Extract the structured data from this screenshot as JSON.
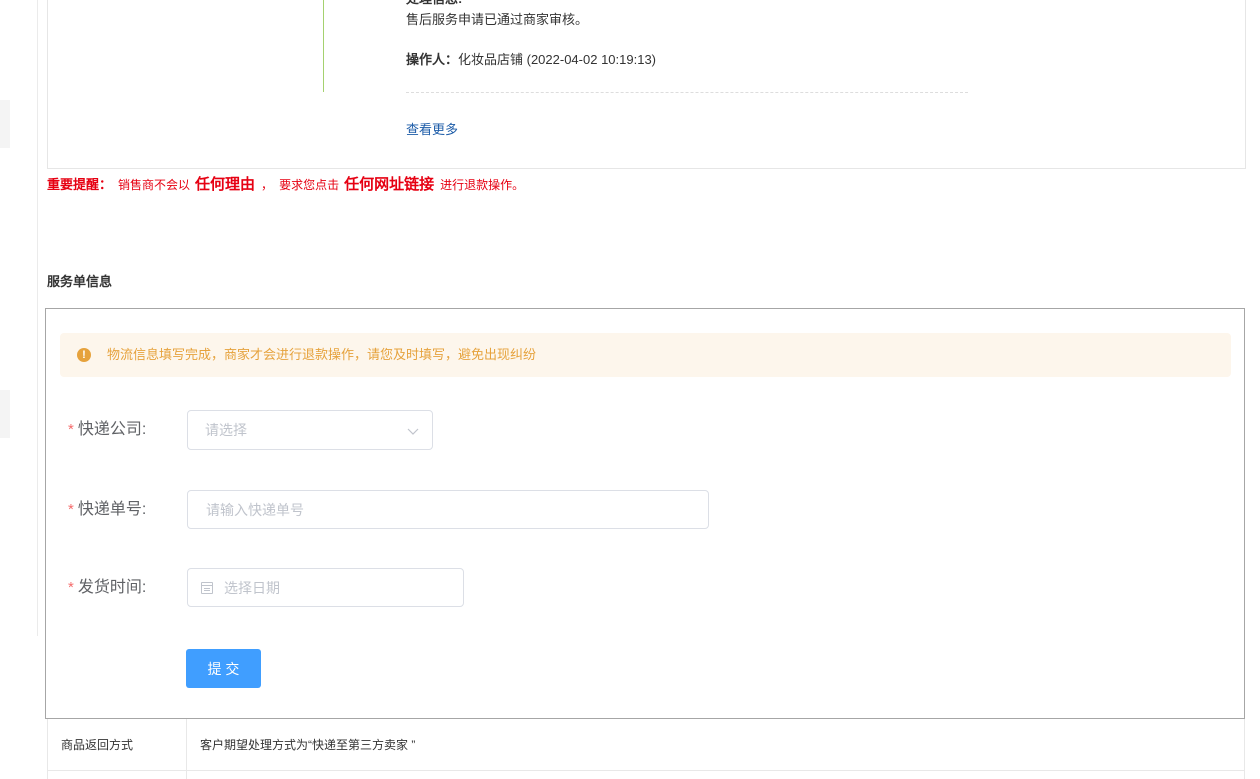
{
  "timeline": {
    "heading": "处理信息:",
    "message": "售后服务申请已通过商家审核。",
    "operator_label": "操作人：",
    "operator_value": "化妆品店铺 (2022-04-02 10:19:13)",
    "more_link": "查看更多"
  },
  "notice": {
    "label": "重要提醒：",
    "part1": "销售商不会以",
    "emphasis1": "任何理由",
    "part2": "，",
    "part3": "要求您点击",
    "emphasis2": "任何网址链接",
    "part4": "进行退款操作。"
  },
  "section_title": "服务单信息",
  "alert": {
    "icon": "warning-circle-icon",
    "icon_glyph": "!",
    "text": "物流信息填写完成，商家才会进行退款操作，请您及时填写，避免出现纠纷"
  },
  "form": {
    "required_mark": "*",
    "courier": {
      "label": "快递公司:",
      "placeholder": "请选择",
      "value": "",
      "icon": "chevron-down-icon"
    },
    "tracking": {
      "label": "快递单号:",
      "placeholder": "请输入快递单号",
      "value": ""
    },
    "ship_date": {
      "label": "发货时间:",
      "placeholder": "选择日期",
      "value": "",
      "icon": "calendar-icon"
    },
    "submit_label": "提 交"
  },
  "table": {
    "rows": [
      {
        "label": "商品返回方式",
        "value": "客户期望处理方式为“快递至第三方卖家 ”"
      }
    ]
  },
  "colors": {
    "accent": "#409eff",
    "link": "#1d5ca8",
    "notice_red": "#e60012",
    "alert_bg": "#fdf6ec",
    "alert_text": "#e6a23c",
    "required": "#f56c6c",
    "timeline_line": "#a5d16f"
  }
}
